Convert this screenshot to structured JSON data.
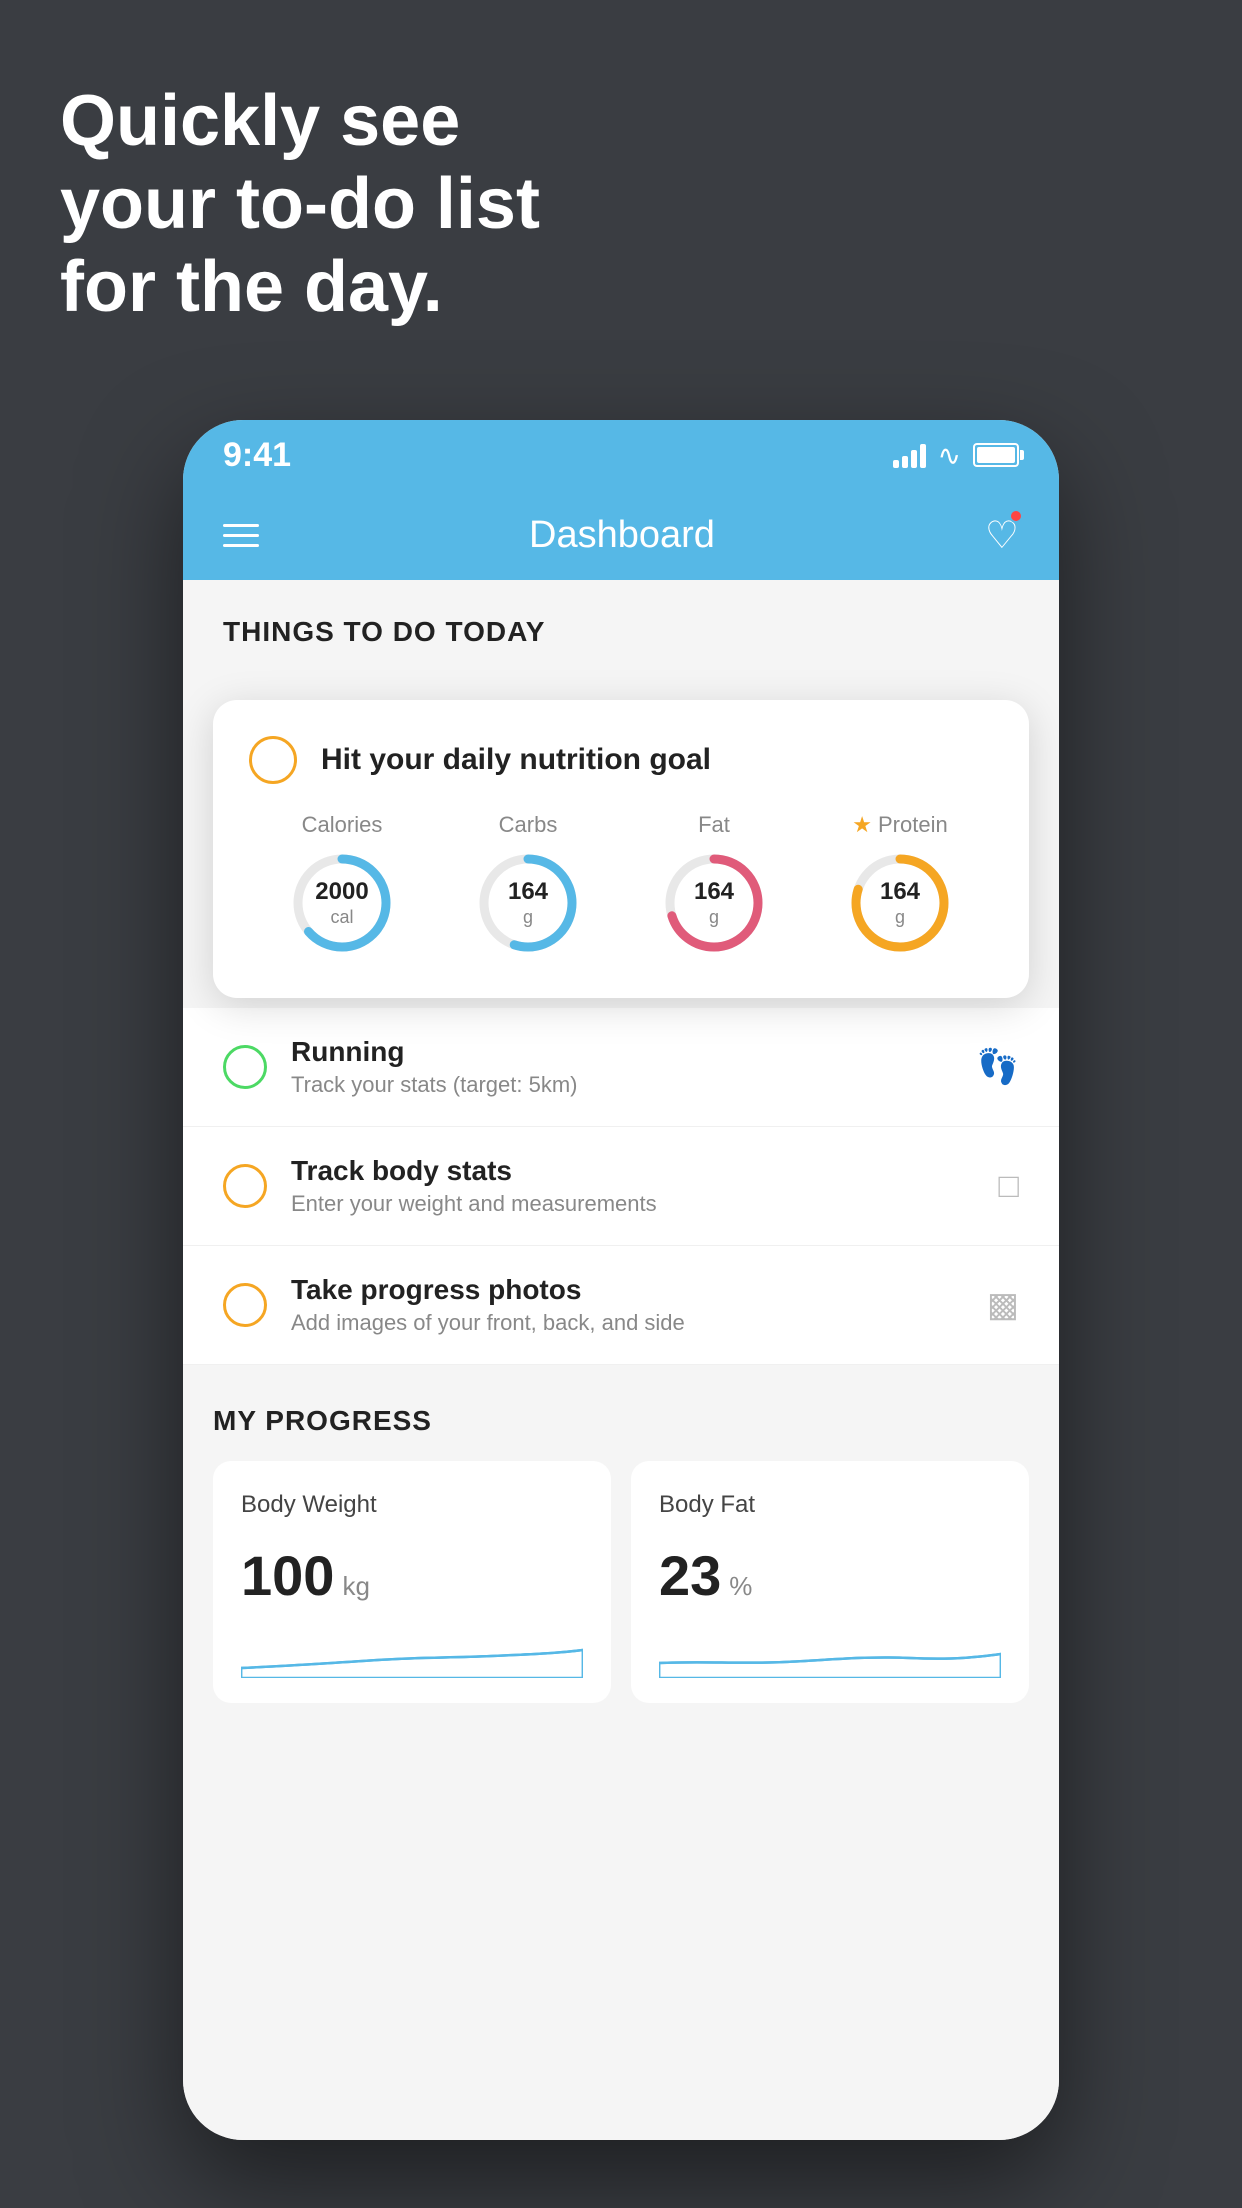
{
  "hero": {
    "line1": "Quickly see",
    "line2": "your to-do list",
    "line3": "for the day."
  },
  "statusBar": {
    "time": "9:41"
  },
  "navBar": {
    "title": "Dashboard"
  },
  "thingsToDo": {
    "sectionTitle": "THINGS TO DO TODAY"
  },
  "nutritionCard": {
    "title": "Hit your daily nutrition goal",
    "items": [
      {
        "label": "Calories",
        "value": "2000",
        "unit": "cal",
        "color": "#56b8e6",
        "pct": 65,
        "star": false
      },
      {
        "label": "Carbs",
        "value": "164",
        "unit": "g",
        "color": "#56b8e6",
        "pct": 55,
        "star": false
      },
      {
        "label": "Fat",
        "value": "164",
        "unit": "g",
        "color": "#e05b7a",
        "pct": 70,
        "star": false
      },
      {
        "label": "Protein",
        "value": "164",
        "unit": "g",
        "color": "#f5a623",
        "pct": 80,
        "star": true
      }
    ]
  },
  "todoItems": [
    {
      "title": "Running",
      "subtitle": "Track your stats (target: 5km)",
      "circleColor": "green",
      "iconLabel": "shoe-icon"
    },
    {
      "title": "Track body stats",
      "subtitle": "Enter your weight and measurements",
      "circleColor": "yellow",
      "iconLabel": "scale-icon"
    },
    {
      "title": "Take progress photos",
      "subtitle": "Add images of your front, back, and side",
      "circleColor": "yellow",
      "iconLabel": "person-icon"
    }
  ],
  "progressSection": {
    "title": "MY PROGRESS",
    "cards": [
      {
        "title": "Body Weight",
        "value": "100",
        "unit": "kg"
      },
      {
        "title": "Body Fat",
        "value": "23",
        "unit": "%"
      }
    ]
  }
}
